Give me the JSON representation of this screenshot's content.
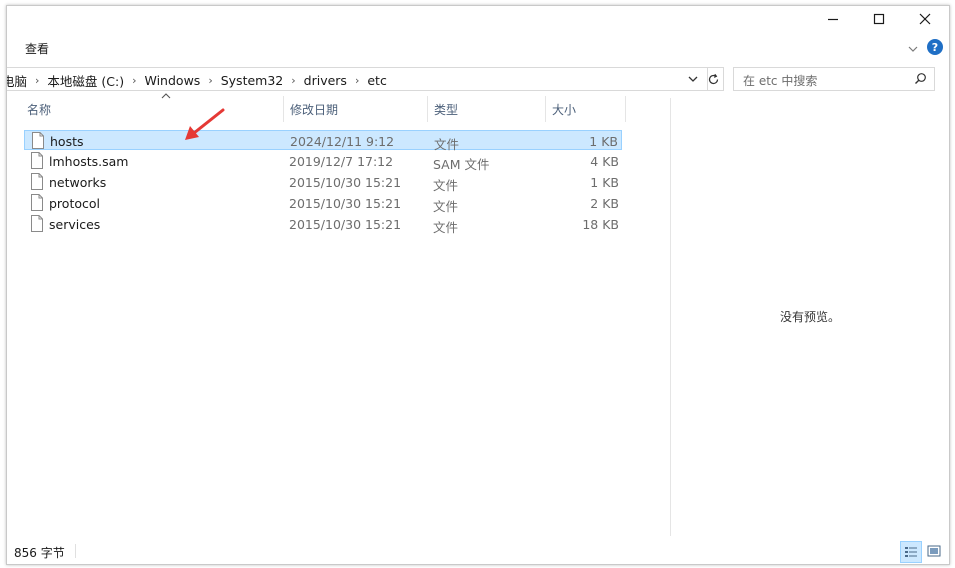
{
  "ribbon": {
    "tab_label": "查看"
  },
  "address": {
    "crumbs": [
      "电脑",
      "本地磁盘 (C:)",
      "Windows",
      "System32",
      "drivers",
      "etc"
    ]
  },
  "search": {
    "placeholder": "在 etc 中搜索"
  },
  "columns": {
    "name": "名称",
    "date": "修改日期",
    "type": "类型",
    "size": "大小"
  },
  "files": [
    {
      "name": "hosts",
      "date": "2024/12/11 9:12",
      "type": "文件",
      "size": "1 KB",
      "selected": true
    },
    {
      "name": "lmhosts.sam",
      "date": "2019/12/7 17:12",
      "type": "SAM 文件",
      "size": "4 KB",
      "selected": false
    },
    {
      "name": "networks",
      "date": "2015/10/30 15:21",
      "type": "文件",
      "size": "1 KB",
      "selected": false
    },
    {
      "name": "protocol",
      "date": "2015/10/30 15:21",
      "type": "文件",
      "size": "2 KB",
      "selected": false
    },
    {
      "name": "services",
      "date": "2015/10/30 15:21",
      "type": "文件",
      "size": "18 KB",
      "selected": false
    }
  ],
  "preview": {
    "empty_text": "没有预览。"
  },
  "status": {
    "text": "856 字节"
  },
  "colors": {
    "selection_bg": "#cce8ff",
    "selection_border": "#99d1ff",
    "annotation_arrow": "#e53935",
    "help_icon": "#1f6fc5"
  },
  "icons": {
    "minimize": "minimize-icon",
    "maximize": "maximize-icon",
    "close": "close-icon",
    "help": "help-icon",
    "file": "file-icon",
    "search": "search-icon",
    "refresh": "refresh-icon"
  }
}
